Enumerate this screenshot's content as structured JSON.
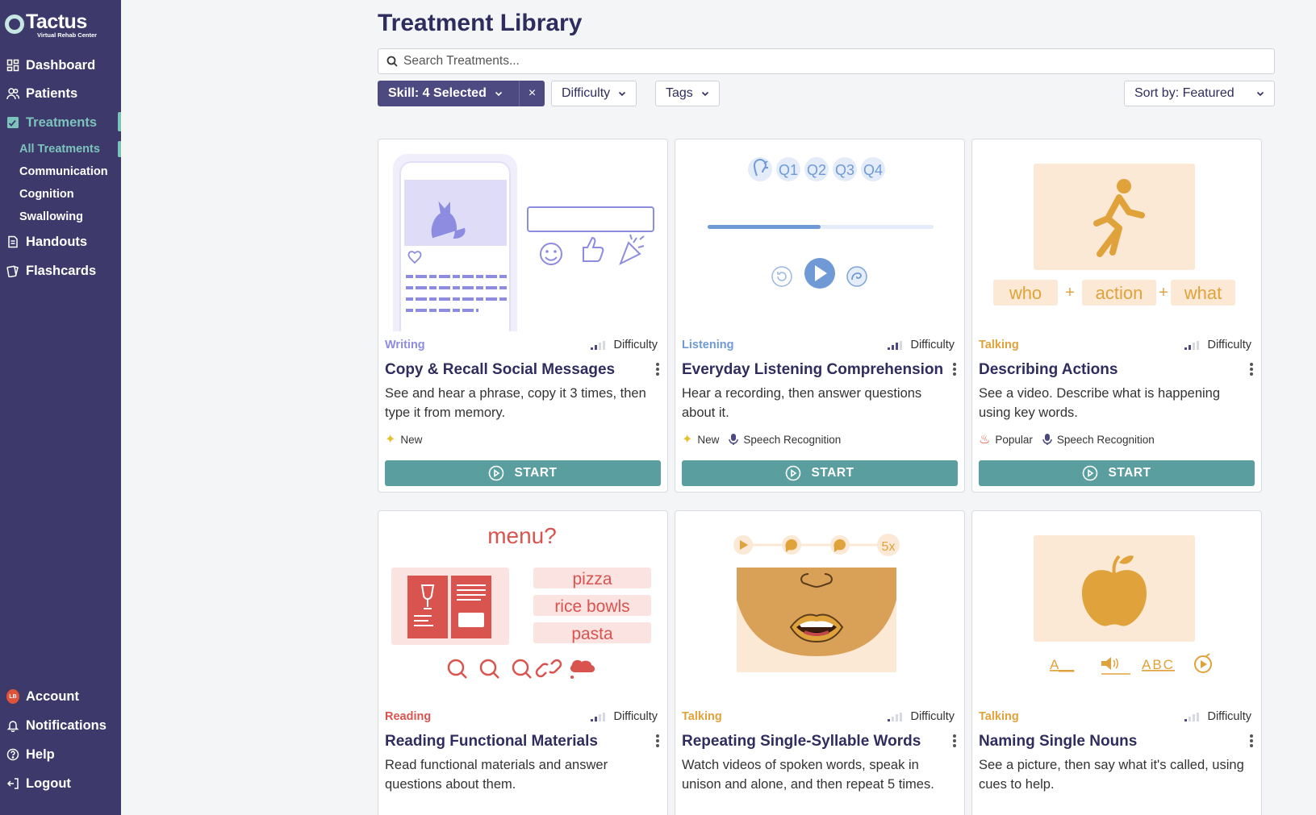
{
  "app": {
    "name": "Tactus",
    "subtitle": "Virtual Rehab Center"
  },
  "sidebar": {
    "items": [
      {
        "label": "Dashboard",
        "icon": "dashboard-icon"
      },
      {
        "label": "Patients",
        "icon": "patients-icon"
      },
      {
        "label": "Treatments",
        "icon": "treatments-icon",
        "active": true
      },
      {
        "label": "Handouts",
        "icon": "handouts-icon"
      },
      {
        "label": "Flashcards",
        "icon": "flashcards-icon"
      }
    ],
    "sub_items": [
      {
        "label": "All Treatments",
        "active": true
      },
      {
        "label": "Communication"
      },
      {
        "label": "Cognition"
      },
      {
        "label": "Swallowing"
      }
    ],
    "bottom": [
      {
        "label": "Account",
        "badge": "LB"
      },
      {
        "label": "Notifications",
        "icon": "bell-icon"
      },
      {
        "label": "Help",
        "icon": "help-icon"
      },
      {
        "label": "Logout",
        "icon": "logout-icon"
      }
    ]
  },
  "page": {
    "title": "Treatment Library",
    "search_placeholder": "Search Treatments..."
  },
  "filters": {
    "skill": "Skill: 4 Selected",
    "clear": "×",
    "difficulty": "Difficulty",
    "tags": "Tags",
    "sort": "Sort by: Featured"
  },
  "colors": {
    "sidebar": "#3d3a6b",
    "accent": "#7cc3bc",
    "start_button": "#5a9ea0",
    "writing": "#8d8ce0",
    "listening": "#6f9ad6",
    "talking": "#e0a23a",
    "reading": "#d9534f"
  },
  "cards": [
    {
      "category": "Writing",
      "difficulty_label": "Difficulty",
      "difficulty_level": 2,
      "title": "Copy & Recall Social Messages",
      "description": "See and hear a phrase, copy it 3 times, then type it from memory.",
      "tags": [
        {
          "icon": "sparkle-icon",
          "label": "New"
        }
      ],
      "start": "START"
    },
    {
      "category": "Listening",
      "difficulty_label": "Difficulty",
      "difficulty_level": 3,
      "title": "Everyday Listening Comprehension",
      "description": "Hear a recording, then answer questions about it.",
      "tags": [
        {
          "icon": "sparkle-icon",
          "label": "New"
        },
        {
          "icon": "microphone-icon",
          "label": "Speech Recognition"
        }
      ],
      "start": "START",
      "art_labels": [
        "Q1",
        "Q2",
        "Q3",
        "Q4"
      ]
    },
    {
      "category": "Talking",
      "difficulty_label": "Difficulty",
      "difficulty_level": 2,
      "title": "Describing Actions",
      "description": "See a video. Describe what is happening using key words.",
      "tags": [
        {
          "icon": "fire-icon",
          "label": "Popular"
        },
        {
          "icon": "microphone-icon",
          "label": "Speech Recognition"
        }
      ],
      "start": "START",
      "art_labels": [
        "who",
        "+",
        "action",
        "+",
        "what"
      ]
    },
    {
      "category": "Reading",
      "difficulty_label": "Difficulty",
      "difficulty_level": 2,
      "title": "Reading Functional Materials",
      "description": "Read functional materials and answer questions about them.",
      "tags": [],
      "start": "START",
      "art_labels": [
        "menu?",
        "pizza",
        "rice bowls",
        "pasta"
      ]
    },
    {
      "category": "Talking",
      "difficulty_label": "Difficulty",
      "difficulty_level": 1,
      "title": "Repeating Single-Syllable Words",
      "description": "Watch videos of spoken words, speak in unison and alone, and then repeat 5 times.",
      "tags": [],
      "start": "START",
      "art_labels": [
        "5x"
      ]
    },
    {
      "category": "Talking",
      "difficulty_label": "Difficulty",
      "difficulty_level": 1,
      "title": "Naming Single Nouns",
      "description": "See a picture, then say what it's called, using cues to help.",
      "tags": [],
      "start": "START",
      "art_labels": [
        "A__",
        "ABC"
      ]
    }
  ]
}
